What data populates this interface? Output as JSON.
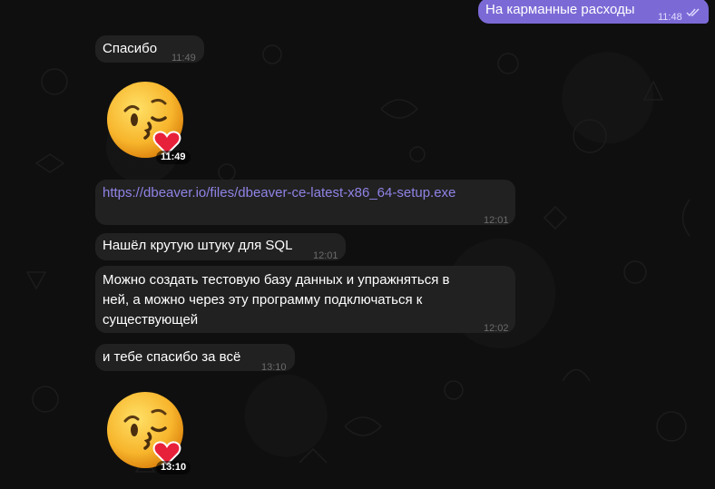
{
  "messages": {
    "outgoing_1": {
      "text": "На карманные расходы",
      "time": "11:48"
    },
    "m1": {
      "text": "Спасибо",
      "time": "11:49"
    },
    "sticker1": {
      "time": "11:49",
      "emoji": "face-blowing-kiss"
    },
    "m2": {
      "link": "https://dbeaver.io/files/dbeaver-ce-latest-x86_64-setup.exe",
      "time": "12:01"
    },
    "m3": {
      "text": "Нашёл крутую штуку для SQL",
      "time": "12:01"
    },
    "m4": {
      "line1": "Можно создать тестовую базу данных и упражняться в",
      "line2": "ней, а можно через эту программу подключаться к",
      "line3": "существующей",
      "time": "12:02"
    },
    "m5": {
      "text": "и тебе спасибо за всё",
      "time": "13:10"
    },
    "sticker2": {
      "time": "13:10",
      "emoji": "face-blowing-kiss"
    }
  },
  "colors": {
    "background": "#0f0f0f",
    "incoming_bubble": "#212121",
    "outgoing_bubble": "#7b6ad6",
    "link": "#8f83e6"
  }
}
